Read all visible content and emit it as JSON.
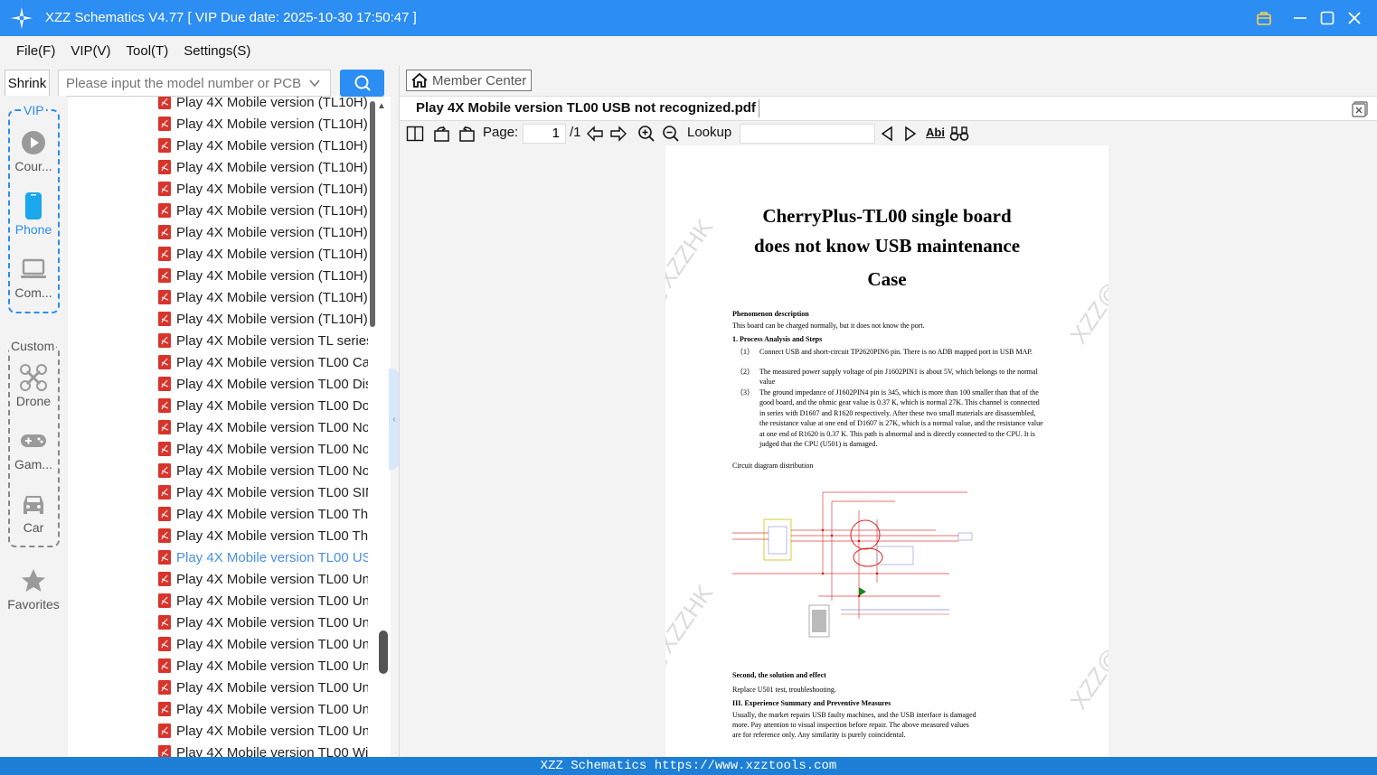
{
  "window": {
    "title": "XZZ Schematics V4.77 [ VIP Due date: 2025-10-30 17:50:47 ]"
  },
  "menu": [
    "File(F)",
    "VIP(V)",
    "Tool(T)",
    "Settings(S)"
  ],
  "search": {
    "shrink_label": "Shrink",
    "placeholder": "Please input the model number or PCB"
  },
  "rail": {
    "vip_label": "VIP",
    "custom_label": "Custom",
    "items": [
      {
        "label": "Cour...",
        "icon": "play-circle-icon"
      },
      {
        "label": "Phone",
        "icon": "phone-icon"
      },
      {
        "label": "Com...",
        "icon": "laptop-icon"
      },
      {
        "label": "Drone",
        "icon": "drone-icon"
      },
      {
        "label": "Gam...",
        "icon": "gamepad-icon"
      },
      {
        "label": "Car",
        "icon": "car-icon"
      },
      {
        "label": "Favorites",
        "icon": "star-icon"
      }
    ]
  },
  "file_list": [
    "Play 4X Mobile version (TL10H)",
    "Play 4X Mobile version (TL10H)",
    "Play 4X Mobile version (TL10H)",
    "Play 4X Mobile version (TL10H)",
    "Play 4X Mobile version (TL10H)",
    "Play 4X Mobile version (TL10H)",
    "Play 4X Mobile version (TL10H)",
    "Play 4X Mobile version (TL10H)",
    "Play 4X Mobile version (TL10H)",
    "Play 4X Mobile version (TL10H)",
    "Play 4X Mobile version (TL10H)",
    "Play 4X Mobile version TL series",
    "Play 4X Mobile version TL00 Ca:",
    "Play 4X Mobile version TL00 Dis",
    "Play 4X Mobile version TL00 Do",
    "Play 4X Mobile version TL00 No",
    "Play 4X Mobile version TL00 No",
    "Play 4X Mobile version TL00 No",
    "Play 4X Mobile version TL00 SIN",
    "Play 4X Mobile version TL00 The",
    "Play 4X Mobile version TL00 The",
    "Play 4X Mobile version TL00 US",
    "Play 4X Mobile version TL00 Un",
    "Play 4X Mobile version TL00 Un",
    "Play 4X Mobile version TL00 Un",
    "Play 4X Mobile version TL00 Un",
    "Play 4X Mobile version TL00 Un",
    "Play 4X Mobile version TL00 Un",
    "Play 4X Mobile version TL00 Un",
    "Play 4X Mobile version TL00 Un",
    "Play 4X Mobile version TL00 Wi"
  ],
  "active_index": 21,
  "viewer": {
    "member_center": "Member Center",
    "tab_title": "Play 4X Mobile version TL00 USB not recognized.pdf",
    "page_label": "Page:",
    "page_current": "1",
    "page_total": "/1",
    "lookup_label": "Lookup",
    "abi_label": "Abi"
  },
  "doc": {
    "title_line1": "CherryPlus-TL00 single board",
    "title_line2": "does not know USB maintenance",
    "title_line3": "Case",
    "phenomenon_heading": "Phenomenon description",
    "phenomenon_text": "This board can be charged normally, but it does not know the port.",
    "process_heading": "1. Process Analysis and Steps",
    "step1_num": "（1）",
    "step1": "Connect USB and short-circuit TP2620PIN6 pin. There is no ADB mapped port in USB MAP.",
    "step2_num": "（2）",
    "step2": "The measured power supply voltage of pin J1602PIN1 is about 5V, which belongs to the normal value",
    "step3_num": "（3）",
    "step3": "The ground impedance of J1602PIN4 pin is 345, which is more than 100 smaller than that of the good board, and the ohmic gear value is 0.37 K, which is normal 27K. This channel is connected in series with D1607 and R1620 respectively. After these two small materials are disassembled, the resistance value at one end of D1607 is 27K, which is a normal value, and the resistance value at one end of R1620 is 0.37 K. This path is abnormal and is directly connected to the CPU. It is judged that the CPU (U501) is damaged.",
    "circuit_label": "Circuit diagram distribution",
    "solution_heading": "Second, the solution and effect",
    "solution_text": "Replace U501 test, troubleshooting.",
    "summary_heading": "III. Experience Summary and Preventive Measures",
    "summary_text": "Usually, the market repairs USB faulty machines, and the USB interface is damaged more. Pay attention to visual inspection before repair. The above measured values are for reference only. Any similarity is purely coincidental.",
    "watermark": "XZZ@XZZHK"
  },
  "status_bar": "XZZ Schematics https://www.xzztools.com",
  "colors": {
    "accent": "#2c8df2",
    "status": "#1d7fd6",
    "active_item": "#4a90e2",
    "pdf_red": "#d9342b"
  }
}
